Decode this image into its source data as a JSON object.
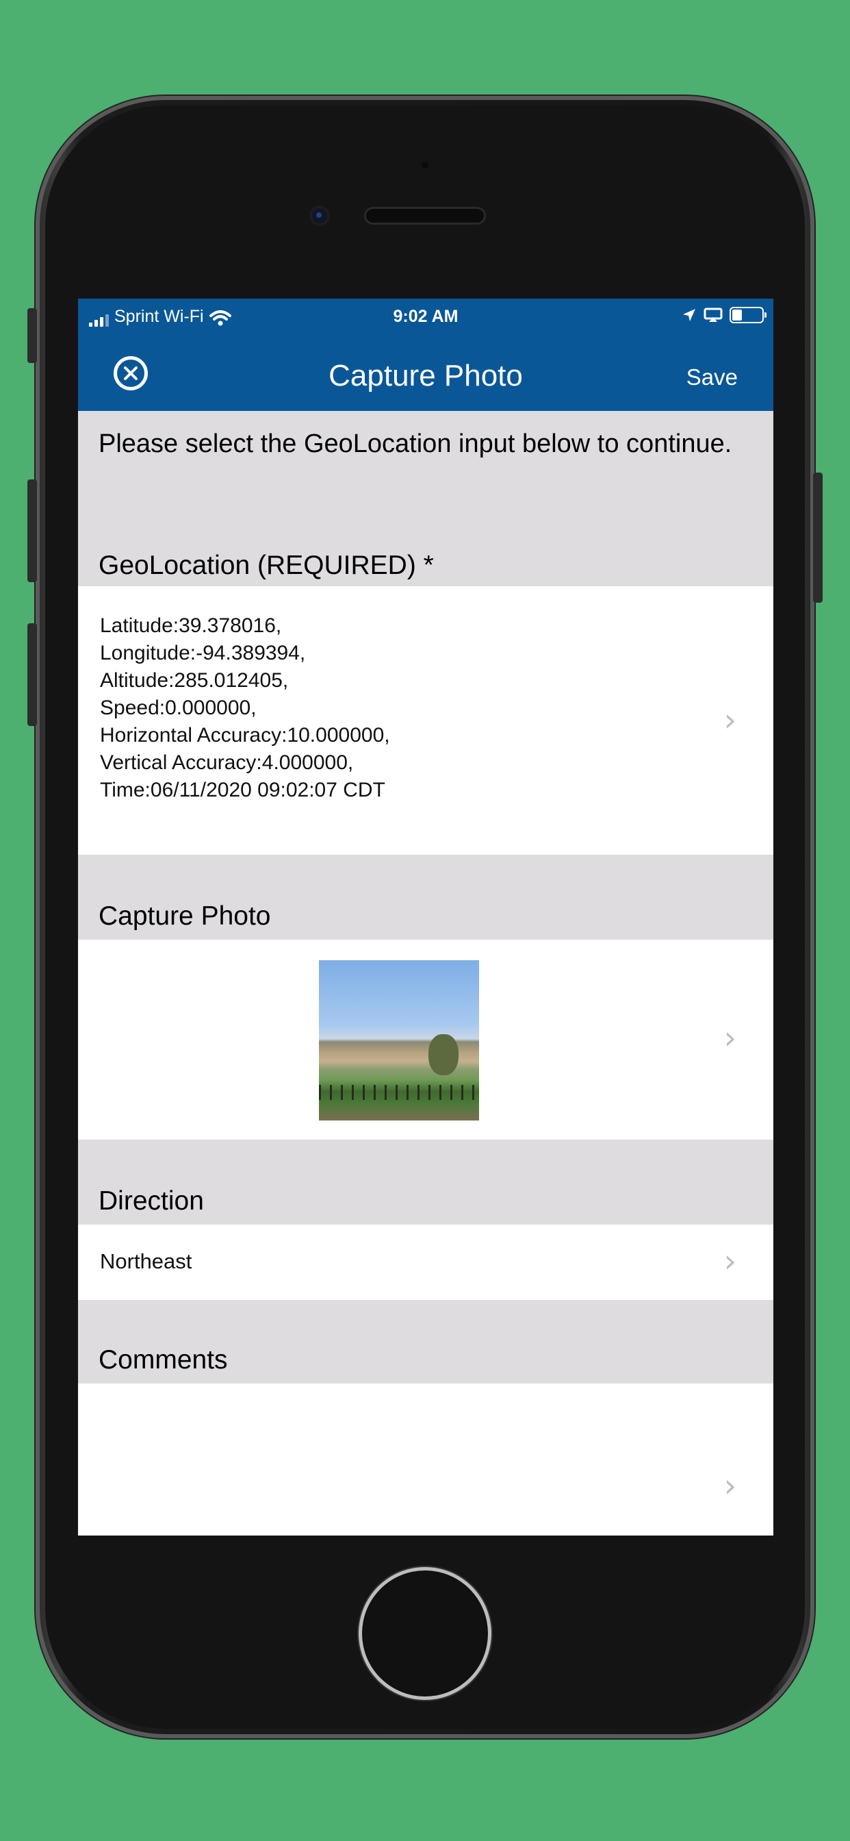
{
  "status_bar": {
    "carrier": "Sprint Wi-Fi",
    "time": "9:02 AM"
  },
  "nav": {
    "title": "Capture Photo",
    "save_label": "Save",
    "close_icon": "close-circle-icon"
  },
  "instruction": "Please select the GeoLocation input below to continue.",
  "geolocation": {
    "header": "GeoLocation (REQUIRED) *",
    "lines": [
      "Latitude:39.378016,",
      "Longitude:-94.389394,",
      "Altitude:285.012405,",
      "Speed:0.000000,",
      "Horizontal Accuracy:10.000000,",
      "Vertical Accuracy:4.000000,",
      "Time:06/11/2020 09:02:07 CDT"
    ]
  },
  "capture_photo": {
    "header": "Capture Photo"
  },
  "direction": {
    "header": "Direction",
    "value": "Northeast"
  },
  "comments": {
    "header": "Comments",
    "value": ""
  },
  "colors": {
    "background": "#4daf70",
    "nav_bar": "#0a5797",
    "section_bg": "#dedcdf"
  }
}
